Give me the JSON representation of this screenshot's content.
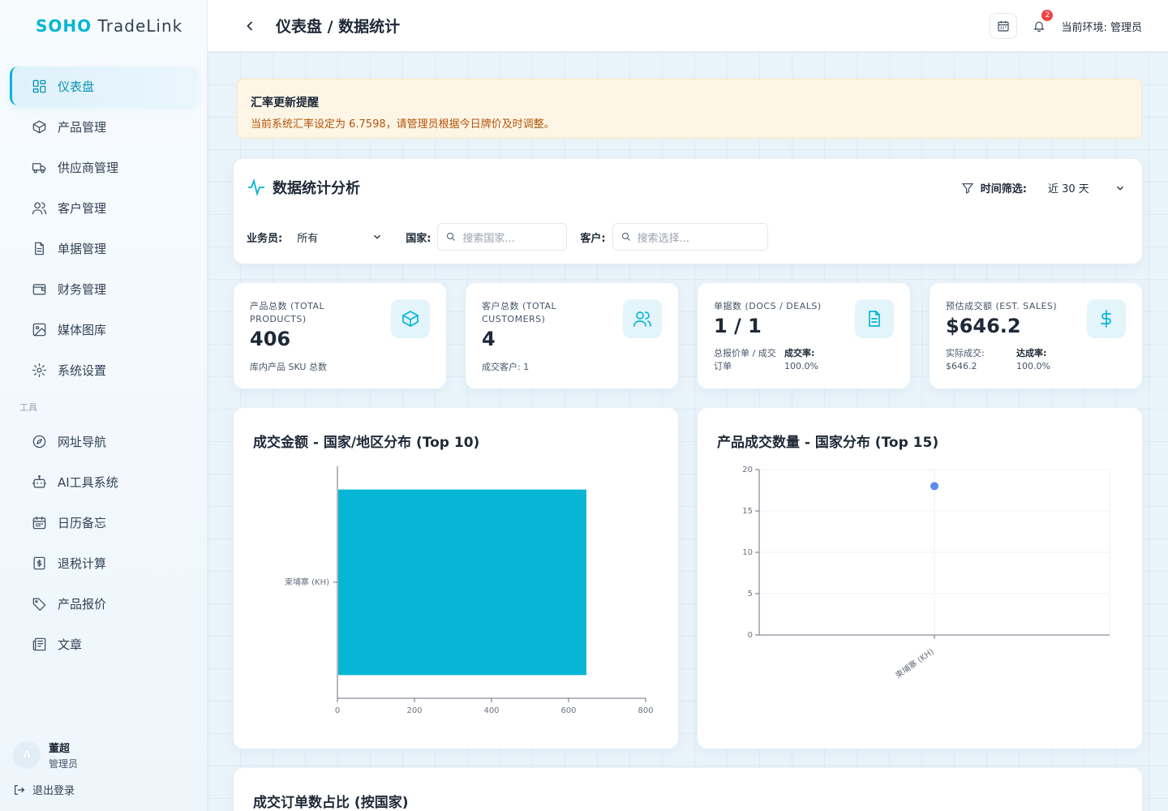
{
  "brand": {
    "part1": "SOHO",
    "part2": " TradeLink"
  },
  "sidebar": {
    "items": [
      {
        "label": "仪表盘",
        "icon": "dashboard-icon",
        "active": true
      },
      {
        "label": "产品管理",
        "icon": "box-icon"
      },
      {
        "label": "供应商管理",
        "icon": "truck-icon"
      },
      {
        "label": "客户管理",
        "icon": "users-icon"
      },
      {
        "label": "单据管理",
        "icon": "document-icon"
      },
      {
        "label": "财务管理",
        "icon": "wallet-icon"
      },
      {
        "label": "媒体图库",
        "icon": "image-icon"
      },
      {
        "label": "系统设置",
        "icon": "gear-icon"
      }
    ],
    "tools_label": "工具",
    "tools": [
      {
        "label": "网址导航",
        "icon": "compass-icon"
      },
      {
        "label": "AI工具系统",
        "icon": "robot-icon"
      },
      {
        "label": "日历备忘",
        "icon": "calendar-icon"
      },
      {
        "label": "退税计算",
        "icon": "calculator-icon"
      },
      {
        "label": "产品报价",
        "icon": "tag-icon"
      },
      {
        "label": "文章",
        "icon": "newspaper-icon"
      }
    ],
    "user": {
      "avatar": "A",
      "name": "董超",
      "role": "管理员"
    },
    "logout": "退出登录"
  },
  "header": {
    "title": "仪表盘 / 数据统计",
    "notification_count": "2",
    "env": "当前环境: 管理员"
  },
  "alert": {
    "title": "汇率更新提醒",
    "message": "当前系统汇率设定为 6.7598，请管理员根据今日牌价及时调整。"
  },
  "filters": {
    "title": "数据统计分析",
    "time_label": "时间筛选:",
    "time_value": "近 30 天",
    "salesperson_label": "业务员:",
    "salesperson_value": "所有",
    "country_label": "国家:",
    "country_placeholder": "搜索国家...",
    "customer_label": "客户:",
    "customer_placeholder": "搜索选择..."
  },
  "stats": {
    "products": {
      "label": "产品总数 (TOTAL PRODUCTS)",
      "value": "406",
      "sub": "库内产品 SKU 总数"
    },
    "customers": {
      "label": "客户总数 (TOTAL CUSTOMERS)",
      "value": "4",
      "sub": "成交客户: 1"
    },
    "docs": {
      "label": "单据数 (DOCS / DEALS)",
      "value": "1 / 1",
      "sub1": "总报价单 / 成交订单",
      "sub2_label": "成交率:",
      "sub2_value": "100.0%"
    },
    "sales": {
      "label": "预估成交额 (EST. SALES)",
      "value": "$646.2",
      "sub1_label": "实际成交:",
      "sub1_value": "$646.2",
      "sub2_label": "达成率:",
      "sub2_value": "100.0%"
    }
  },
  "chart_data": [
    {
      "type": "bar",
      "orientation": "horizontal",
      "title": "成交金额 - 国家/地区分布 (Top 10)",
      "categories": [
        "柬埔寨 (KH)"
      ],
      "values": [
        646.2
      ],
      "xlim": [
        0,
        800
      ],
      "xticks": [
        "0",
        "200",
        "400",
        "600",
        "800"
      ],
      "color": "#06b6d4",
      "grid": false
    },
    {
      "type": "scatter",
      "title": "产品成交数量 - 国家分布 (Top 15)",
      "categories": [
        "柬埔寨 (KH)"
      ],
      "values": [
        18
      ],
      "ylim": [
        0,
        20
      ],
      "yticks": [
        "0",
        "5",
        "10",
        "15",
        "20"
      ],
      "color": "#5b8def",
      "grid": true
    }
  ],
  "bottom_card": {
    "title": "成交订单数占比 (按国家)"
  }
}
